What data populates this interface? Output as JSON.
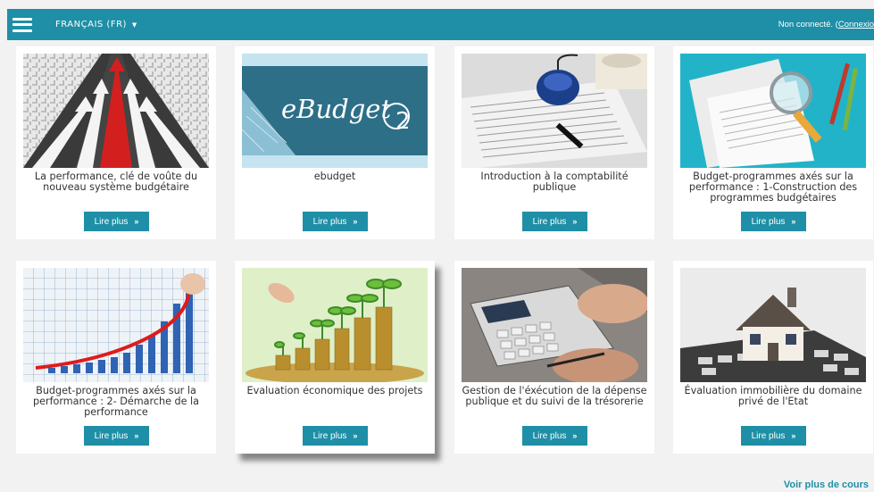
{
  "header": {
    "menu_icon": "hamburger-icon",
    "language": "FRANÇAIS (FR)",
    "caret_icon": "caret-down-icon",
    "status_text": "Non connecté. (",
    "login_link": "Connexio",
    "bar_color": "#1e8fa6"
  },
  "courses": [
    {
      "title": "La performance, clé de voûte du nouveau système budgétaire",
      "button": "Lire plus",
      "image": "highway-arrows-image"
    },
    {
      "title": "ebudget",
      "button": "Lire plus",
      "image": "ebudget2-logo-image",
      "image_text": "eBudget",
      "image_number": "2"
    },
    {
      "title": "Introduction à la comptabilité publique",
      "button": "Lire plus",
      "image": "mouse-newspaper-image"
    },
    {
      "title": "Budget-programmes axés sur la performance : 1-Construction des programmes budgétaires",
      "button": "Lire plus",
      "image": "magnifier-documents-image"
    },
    {
      "title": "Budget-programmes axés sur la performance : 2- Démarche de la performance",
      "button": "Lire plus",
      "image": "growth-chart-image"
    },
    {
      "title": "Evaluation économique des projets",
      "button": "Lire plus",
      "image": "coins-plants-image"
    },
    {
      "title": "Gestion de l'éxécution de la dépense publique et du suivi de la trésorerie",
      "button": "Lire plus",
      "image": "calculator-hands-image"
    },
    {
      "title": "Évaluation immobilière du domaine privé de l'Etat",
      "button": "Lire plus",
      "image": "house-calculator-image"
    }
  ],
  "more_link": "Voir plus de cours"
}
